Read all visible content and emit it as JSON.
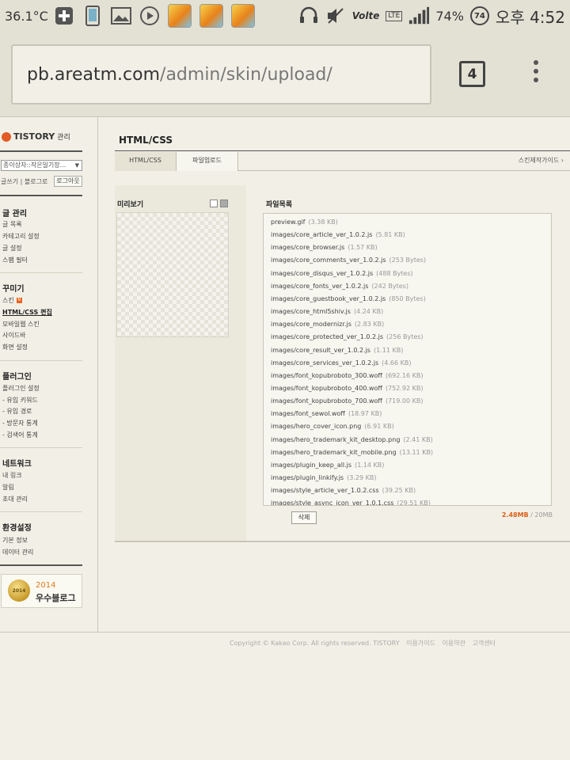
{
  "statusbar": {
    "temperature": "36.1°C",
    "battery": "74%",
    "battery_icon_text": "74",
    "volte": "Volte",
    "lte": "LTE",
    "time": "오후 4:52",
    "icons": [
      "plus-icon",
      "phone-icon",
      "gallery-icon",
      "play-icon",
      "game-icon",
      "game-icon",
      "game-icon",
      "headset-icon",
      "mute-icon",
      "signal-icon"
    ]
  },
  "browser": {
    "url_host": "pb.areatm.com",
    "url_path": "/admin/skin/upload/",
    "tab_count": "4"
  },
  "sidebar": {
    "brand": "TISTORY",
    "brand_sub": "관리",
    "blog_select": "종이상자::작은일기장...",
    "link_write": "글쓰기",
    "link_blog": "블로그로",
    "logout": "로그아웃",
    "sections": [
      {
        "title": "글 관리",
        "items": [
          "글 목록",
          "카테고리 설정",
          "글 설정",
          "스팸 필터"
        ]
      },
      {
        "title": "꾸미기",
        "items": [
          "스킨",
          "HTML/CSS 편집",
          "모바일웹 스킨",
          "사이드바",
          "화면 설정"
        ]
      },
      {
        "title": "플러그인",
        "items": [
          "플러그인 설정",
          "- 유입 키워드",
          "- 유입 경로",
          "- 방문자 통계",
          "- 검색어 통계"
        ]
      },
      {
        "title": "네트워크",
        "items": [
          "내 링크",
          "알림",
          "초대 관리"
        ]
      },
      {
        "title": "환경설정",
        "items": [
          "기본 정보",
          "데이터 관리"
        ]
      }
    ],
    "new_badge": "N",
    "award_year": "2014",
    "award_name": "우수블로그",
    "medal_text": "2014"
  },
  "main": {
    "title": "HTML/CSS",
    "tabs": [
      "HTML/CSS",
      "파일업로드"
    ],
    "skin_guide": "스킨제작가이드 ›",
    "preview_title": "미리보기",
    "filelist_title": "파일목록",
    "files": [
      {
        "name": "preview.gif",
        "size": "(3.38 KB)"
      },
      {
        "name": "images/core_article_ver_1.0.2.js",
        "size": "(5.81 KB)"
      },
      {
        "name": "images/core_browser.js",
        "size": "(1.57 KB)"
      },
      {
        "name": "images/core_comments_ver_1.0.2.js",
        "size": "(253 Bytes)"
      },
      {
        "name": "images/core_disqus_ver_1.0.2.js",
        "size": "(488 Bytes)"
      },
      {
        "name": "images/core_fonts_ver_1.0.2.js",
        "size": "(242 Bytes)"
      },
      {
        "name": "images/core_guestbook_ver_1.0.2.js",
        "size": "(850 Bytes)"
      },
      {
        "name": "images/core_html5shiv.js",
        "size": "(4.24 KB)"
      },
      {
        "name": "images/core_modernizr.js",
        "size": "(2.83 KB)"
      },
      {
        "name": "images/core_protected_ver_1.0.2.js",
        "size": "(256 Bytes)"
      },
      {
        "name": "images/core_result_ver_1.0.2.js",
        "size": "(1.11 KB)"
      },
      {
        "name": "images/core_services_ver_1.0.2.js",
        "size": "(4.66 KB)"
      },
      {
        "name": "images/font_kopubroboto_300.woff",
        "size": "(692.16 KB)"
      },
      {
        "name": "images/font_kopubroboto_400.woff",
        "size": "(752.92 KB)"
      },
      {
        "name": "images/font_kopubroboto_700.woff",
        "size": "(719.00 KB)"
      },
      {
        "name": "images/font_sewol.woff",
        "size": "(18.97 KB)"
      },
      {
        "name": "images/hero_cover_icon.png",
        "size": "(6.91 KB)"
      },
      {
        "name": "images/hero_trademark_kit_desktop.png",
        "size": "(2.41 KB)"
      },
      {
        "name": "images/hero_trademark_kit_mobile.png",
        "size": "(13.11 KB)"
      },
      {
        "name": "images/plugin_keep_all.js",
        "size": "(1.14 KB)"
      },
      {
        "name": "images/plugin_linkify.js",
        "size": "(3.29 KB)"
      },
      {
        "name": "images/style_article_ver_1.0.2.css",
        "size": "(39.25 KB)"
      },
      {
        "name": "images/style_async_icon_ver_1.0.1.css",
        "size": "(29.51 KB)"
      }
    ],
    "delete_button": "삭제",
    "usage_used": "2.48MB",
    "usage_total": " / 20MB"
  },
  "footer": {
    "copyright": "Copyright © Kakao Corp. All rights reserved. TISTORY",
    "links": [
      "이용가이드",
      "이용약관",
      "고객센터"
    ]
  }
}
